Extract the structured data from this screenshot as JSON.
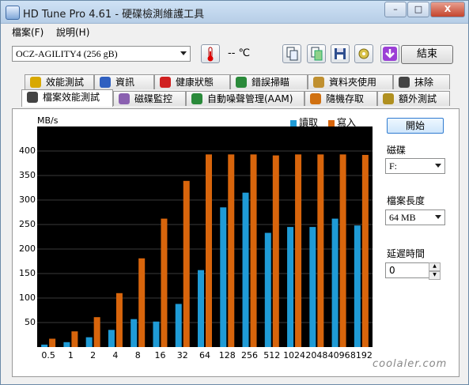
{
  "window": {
    "title": "HD Tune Pro 4.61 - 硬碟檢測維護工具",
    "buttons": {
      "minimize": "–",
      "maximize": "□",
      "close": "X"
    }
  },
  "menu": {
    "file": "檔案(F)",
    "help": "說明(H)"
  },
  "toolbar": {
    "drive": "OCZ-AGILITY4 (256 gB)",
    "temperature": "-- ℃",
    "exit_label": "結束",
    "icons": [
      "copy-text-icon",
      "copy-screenshot-icon",
      "save-icon",
      "settings-icon",
      "download-icon"
    ]
  },
  "tabs_top": [
    {
      "label": "效能測試",
      "icon": "benchmark-icon"
    },
    {
      "label": "資訊",
      "icon": "info-icon"
    },
    {
      "label": "健康狀態",
      "icon": "health-icon"
    },
    {
      "label": "錯誤掃瞄",
      "icon": "error-scan-icon"
    },
    {
      "label": "資料夾使用",
      "icon": "folder-icon"
    },
    {
      "label": "抹除",
      "icon": "erase-icon"
    }
  ],
  "tabs_bottom": [
    {
      "label": "檔案效能測試",
      "icon": "file-benchmark-icon",
      "active": true
    },
    {
      "label": "磁碟監控",
      "icon": "disk-monitor-icon"
    },
    {
      "label": "自動噪聲管理(AAM)",
      "icon": "speaker-icon"
    },
    {
      "label": "隨機存取",
      "icon": "random-access-icon"
    },
    {
      "label": "額外測試",
      "icon": "extra-tests-icon"
    }
  ],
  "side": {
    "start_label": "開始",
    "disk_label": "磁碟",
    "disk_value": "F:",
    "file_length_label": "檔案長度",
    "file_length_value": "64 MB",
    "delay_label": "延遲時間",
    "delay_value": "0"
  },
  "watermark": "coolaler.com",
  "colors": {
    "read": "#1f9bd6",
    "write": "#d8650c",
    "plot_bg": "#000000"
  },
  "chart_data": {
    "type": "bar",
    "ylabel": "MB/s",
    "ylim": [
      0,
      450
    ],
    "yticks": [
      50,
      100,
      150,
      200,
      250,
      300,
      350,
      400
    ],
    "categories": [
      "0.5",
      "1",
      "2",
      "4",
      "8",
      "16",
      "32",
      "64",
      "128",
      "256",
      "512",
      "1024",
      "2048",
      "4096",
      "8192"
    ],
    "series": [
      {
        "name": "讀取",
        "values": [
          5,
          10,
          20,
          35,
          57,
          52,
          88,
          157,
          285,
          315,
          233,
          245,
          245,
          262,
          248
        ]
      },
      {
        "name": "寫入",
        "values": [
          17,
          32,
          61,
          110,
          181,
          262,
          339,
          393,
          393,
          393,
          391,
          393,
          393,
          393,
          392
        ]
      }
    ],
    "legend": "top-right",
    "grid": true
  }
}
